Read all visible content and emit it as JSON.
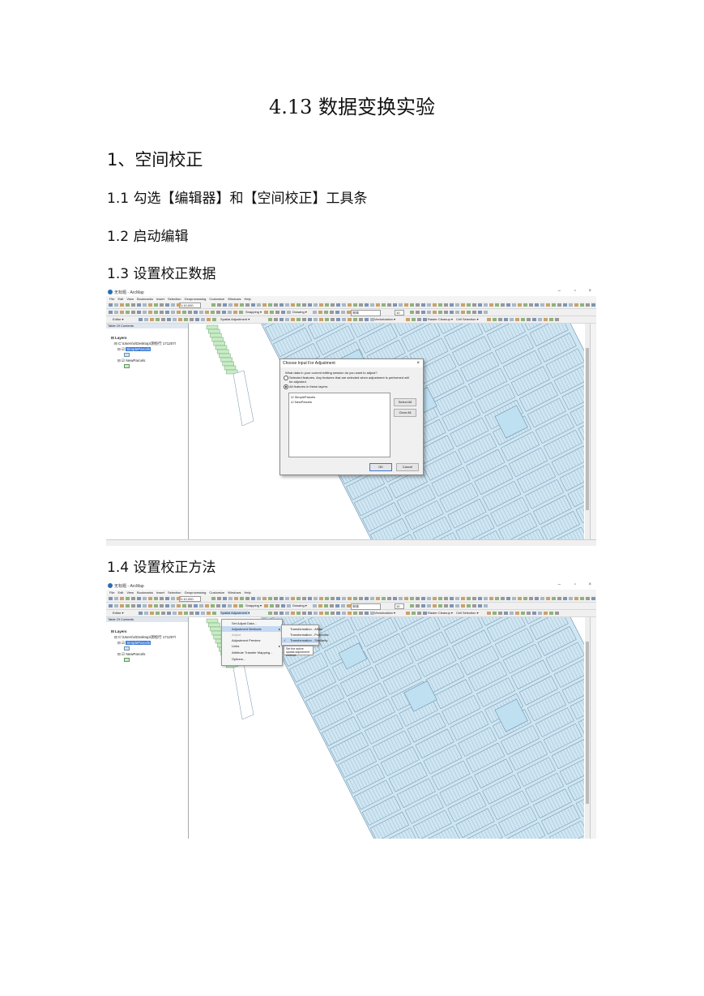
{
  "doc": {
    "title": "4.13 数据变换实验",
    "h1": "1、空间校正",
    "step1": "1.1 勾选【编辑器】和【空间校正】工具条",
    "step2": "1.2 启动编辑",
    "step3": "1.3 设置校正数据",
    "step4": "1.4 设置校正方法"
  },
  "app": {
    "window_title": "无标题 - ArcMap",
    "menus": [
      "File",
      "Edit",
      "View",
      "Bookmarks",
      "Insert",
      "Selection",
      "Geoprocessing",
      "Customize",
      "Windows",
      "Help"
    ],
    "scale": "1:10,000",
    "snapping_label": "Snapping ▾",
    "drawing_label": "Drawing ▾",
    "font_name": "宋体",
    "font_size": "10",
    "editor_label": "Editor ▾",
    "spatial_adjustment_label": "Spatial Adjustment ▾",
    "vectorization_label": "Vectorization ▾",
    "raster_cleanup_label": "Raster Cleanup ▾",
    "cell_selection_label": "Cell Selection ▾",
    "toc_title": "Table Of Contents",
    "toc_layers": "Layers",
    "toc_path": "C:\\Users\\x\\Desktop\\测绘行 171207\\",
    "layer1": "SimpleParcels",
    "layer2": "NewParcels"
  },
  "dialog": {
    "title": "Choose Input For Adjustment",
    "question": "What data in your current editing session do you want to adjust?",
    "option1": "Selected features.  Any features that are selected when adjustment is performed will",
    "option1_cont": "be adjusted.",
    "option2": "All features in these layers:",
    "list": [
      "SimpleParcels",
      "NewParcels"
    ],
    "select_all": "Select All",
    "clear_all": "Clear All",
    "ok": "OK",
    "cancel": "Cancel"
  },
  "menu": {
    "items": [
      "Set Adjust Data...",
      "Adjustment Methods",
      "Adjust",
      "Adjustment Preview",
      "Links",
      "Attribute Transfer Mapping...",
      "Options..."
    ],
    "submenu": [
      "Transformation - Affine",
      "Transformation - Projective",
      "Transformation - Similarity"
    ],
    "tooltip": "Set the active spatial adjustment method."
  },
  "colors": {
    "parcel_fill": "#cfe6f3",
    "parcel_line": "#6d8fa8",
    "parcel_green": "#c9ecc7",
    "selection": "#3a78d6"
  }
}
